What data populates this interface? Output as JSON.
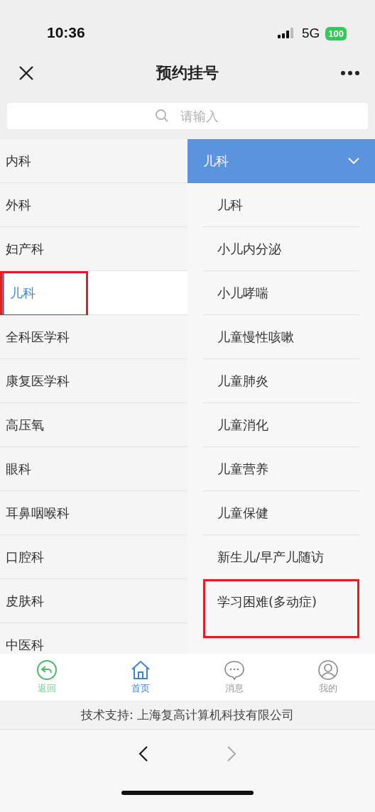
{
  "status_bar": {
    "time": "10:36",
    "network": "5G",
    "battery": "100"
  },
  "nav": {
    "title": "预约挂号"
  },
  "search": {
    "placeholder": "请输入"
  },
  "departments": [
    {
      "label": "内科",
      "selected": false,
      "annotated": false
    },
    {
      "label": "外科",
      "selected": false,
      "annotated": false
    },
    {
      "label": "妇产科",
      "selected": false,
      "annotated": false
    },
    {
      "label": "儿科",
      "selected": true,
      "annotated": true
    },
    {
      "label": "全科医学科",
      "selected": false,
      "annotated": false
    },
    {
      "label": "康复医学科",
      "selected": false,
      "annotated": false
    },
    {
      "label": "高压氧",
      "selected": false,
      "annotated": false
    },
    {
      "label": "眼科",
      "selected": false,
      "annotated": false
    },
    {
      "label": "耳鼻咽喉科",
      "selected": false,
      "annotated": false
    },
    {
      "label": "口腔科",
      "selected": false,
      "annotated": false
    },
    {
      "label": "皮肤科",
      "selected": false,
      "annotated": false
    },
    {
      "label": "中医科",
      "selected": false,
      "annotated": false
    }
  ],
  "subdepartment_header": {
    "label": "儿科",
    "expanded": true
  },
  "subdepartments": [
    {
      "label": "儿科",
      "annotated": false
    },
    {
      "label": "小儿内分泌",
      "annotated": false
    },
    {
      "label": "小儿哮喘",
      "annotated": false
    },
    {
      "label": "儿童慢性咳嗽",
      "annotated": false
    },
    {
      "label": "儿童肺炎",
      "annotated": false
    },
    {
      "label": "儿童消化",
      "annotated": false
    },
    {
      "label": "儿童营养",
      "annotated": false
    },
    {
      "label": "儿童保健",
      "annotated": false
    },
    {
      "label": "新生儿/早产儿随访",
      "annotated": false
    },
    {
      "label": "学习困难(多动症)",
      "annotated": true
    }
  ],
  "tab_bar": [
    {
      "kind": "back",
      "label": "返回",
      "selected": false
    },
    {
      "kind": "home",
      "label": "首页",
      "selected": true
    },
    {
      "kind": "message",
      "label": "消息",
      "selected": false
    },
    {
      "kind": "profile",
      "label": "我的",
      "selected": false
    }
  ],
  "footer": {
    "text": "技术支持: 上海复高计算机科技有限公司"
  }
}
